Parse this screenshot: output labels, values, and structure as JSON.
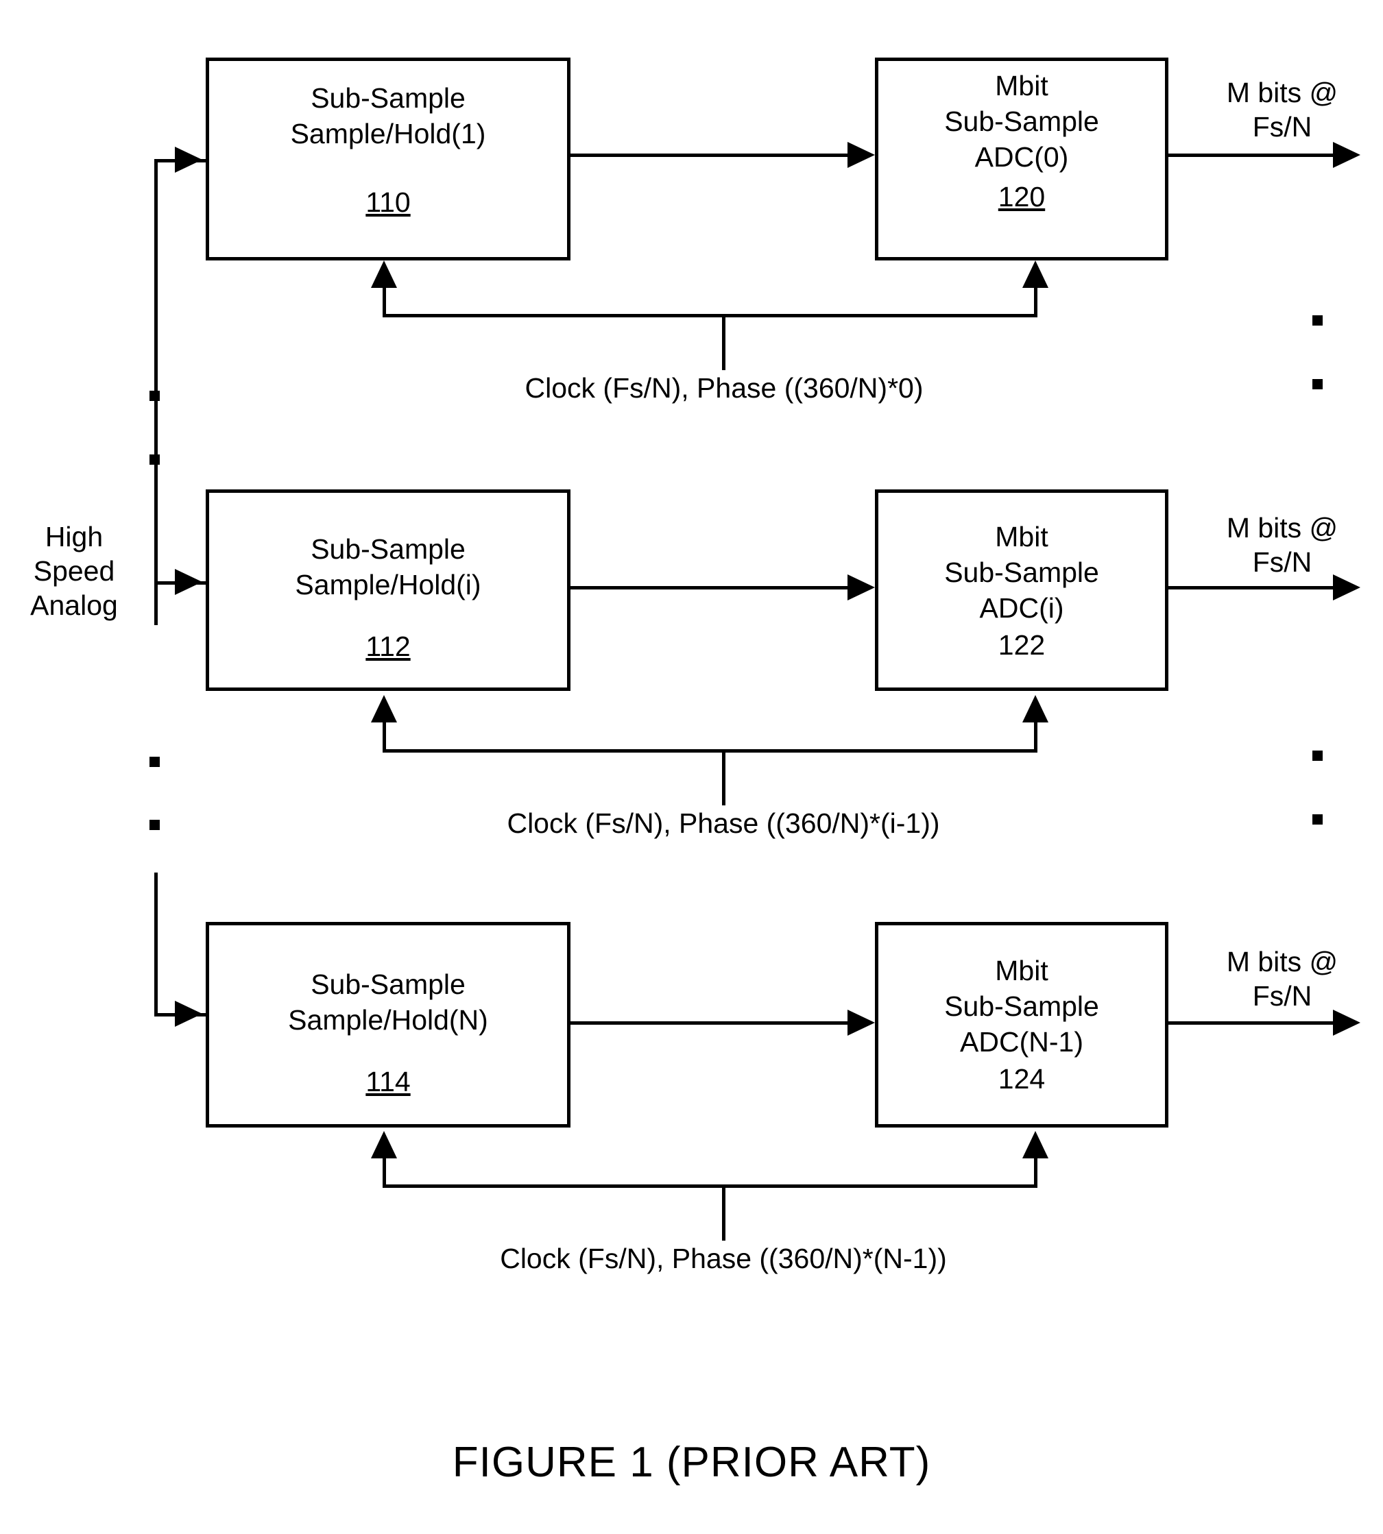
{
  "figure": {
    "caption": "FIGURE 1 (PRIOR ART)",
    "input_label_lines": [
      "High",
      "Speed",
      "Analog"
    ]
  },
  "rows": [
    {
      "sh": {
        "line1": "Sub-Sample",
        "line2": "Sample/Hold(1)",
        "ref": "110",
        "ref_underlined": true
      },
      "adc": {
        "line1": "Mbit",
        "line2": "Sub-Sample",
        "line3": "ADC(0)",
        "ref": "120",
        "ref_underlined": true
      },
      "output": {
        "line1": "M bits @",
        "line2": "Fs/N"
      },
      "clock": "Clock (Fs/N), Phase ((360/N)*0)"
    },
    {
      "sh": {
        "line1": "Sub-Sample",
        "line2": "Sample/Hold(i)",
        "ref": "112",
        "ref_underlined": true
      },
      "adc": {
        "line1": "Mbit",
        "line2": "Sub-Sample",
        "line3": "ADC(i)",
        "ref": "122",
        "ref_underlined": false
      },
      "output": {
        "line1": "M bits @",
        "line2": "Fs/N"
      },
      "clock": "Clock (Fs/N), Phase ((360/N)*(i-1))"
    },
    {
      "sh": {
        "line1": "Sub-Sample",
        "line2": "Sample/Hold(N)",
        "ref": "114",
        "ref_underlined": true
      },
      "adc": {
        "line1": "Mbit",
        "line2": "Sub-Sample",
        "line3": "ADC(N-1)",
        "ref": "124",
        "ref_underlined": false
      },
      "output": {
        "line1": "M bits @",
        "line2": "Fs/N"
      },
      "clock": "Clock (Fs/N), Phase ((360/N)*(N-1))"
    }
  ],
  "ellipses": {
    "left_upper": [
      "▪",
      "▪"
    ],
    "left_lower": [
      "▪",
      "▪"
    ],
    "right_upper": [
      "▪",
      "▪"
    ],
    "right_lower": [
      "▪",
      "▪"
    ]
  },
  "colors": {
    "ink": "#000000",
    "paper": "#ffffff"
  }
}
